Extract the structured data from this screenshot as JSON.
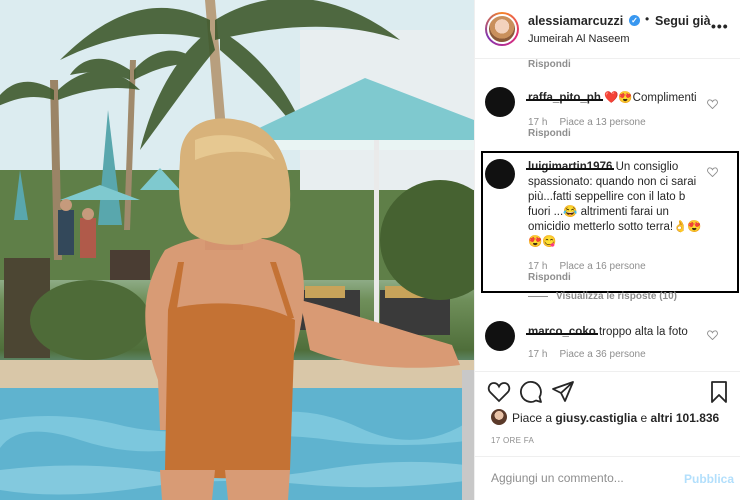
{
  "post": {
    "username": "alessiamarcuzzi",
    "follow_label": "Segui già",
    "dot": "•",
    "location": "Jumeirah Al Naseem",
    "more_icon": "more-horizontal-icon"
  },
  "comments": {
    "top_reply_label": "Rispondi",
    "items": [
      {
        "user": "raffa_pito_ph",
        "text": " ❤️😍Complimenti",
        "time": "17 h",
        "likes": "Piace a 13 persone",
        "reply": "Rispondi"
      },
      {
        "user": "luigimartin1976",
        "text": " Un consiglio spassionato: quando non ci sarai più...fatti seppellire con il lato b fuori ...😂 altrimenti farai un omicidio metterlo sotto terra!👌😍😍😋",
        "time": "17 h",
        "likes": "Place a 16 persone",
        "reply": "Rispondi"
      },
      {
        "user": "marco_coko",
        "text": " troppo alta la foto",
        "time": "17 h",
        "likes": "Piace a 36 persone",
        "reply": ""
      }
    ],
    "view_replies": "Visualizza le risposte (10)"
  },
  "actions": {
    "like_icon": "heart-icon",
    "comment_icon": "comment-icon",
    "share_icon": "send-icon",
    "save_icon": "bookmark-icon"
  },
  "likes": {
    "prefix": "Piace a ",
    "user": "giusy.castiglia",
    "middle": " e ",
    "others": "altri 101.836"
  },
  "timestamp": "17 ORE FA",
  "add_comment": {
    "placeholder": "Aggiungi un commento...",
    "publish_label": "Pubblica"
  }
}
